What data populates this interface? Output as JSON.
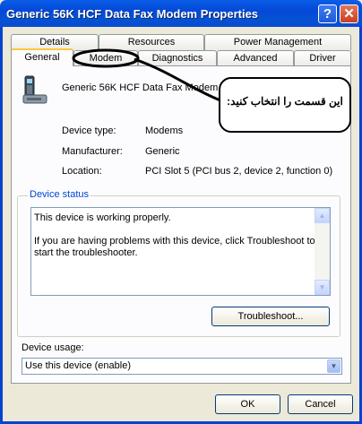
{
  "window": {
    "title": "Generic 56K HCF Data Fax Modem Properties"
  },
  "titlebar_buttons": {
    "help": "?",
    "close": "✕"
  },
  "tabs_row1": [
    "Details",
    "Resources",
    "Power Management"
  ],
  "tabs_row2": [
    "General",
    "Modem",
    "Diagnostics",
    "Advanced",
    "Driver"
  ],
  "device": {
    "icon": "modem-phone-icon",
    "name": "Generic 56K HCF Data Fax Modem",
    "type_label": "Device type:",
    "type_value": "Modems",
    "manufacturer_label": "Manufacturer:",
    "manufacturer_value": "Generic",
    "location_label": "Location:",
    "location_value": "PCI Slot 5 (PCI bus 2, device 2, function 0)"
  },
  "status": {
    "group_label": "Device status",
    "line1": "This device is working properly.",
    "line2": "If you are having problems with this device, click Troubleshoot to",
    "line3": "start the troubleshooter.",
    "troubleshoot_label": "Troubleshoot..."
  },
  "usage": {
    "label": "Device usage:",
    "value": "Use this device (enable)"
  },
  "footer": {
    "ok_label": "OK",
    "cancel_label": "Cancel"
  },
  "annotation": {
    "text": "این قسمت را انتخاب کنید:"
  },
  "colors": {
    "titlebar": "#0a5ee8",
    "active_tab_accent": "#ffc83c",
    "group_label": "#0046d5"
  }
}
